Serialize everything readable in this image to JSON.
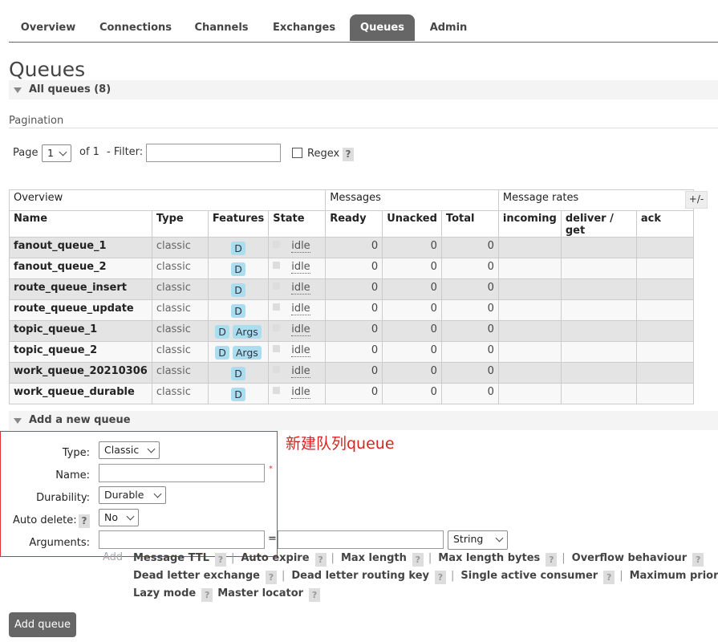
{
  "tabs": [
    "Overview",
    "Connections",
    "Channels",
    "Exchanges",
    "Queues",
    "Admin"
  ],
  "page_title": "Queues",
  "all_queues_label": "All queues (8)",
  "pagination": {
    "label": "Pagination",
    "page_label": "Page",
    "page_value": "1",
    "of_label": "of 1",
    "filter_label": "- Filter:",
    "filter_value": "",
    "regex_label": "Regex",
    "help": "?"
  },
  "table": {
    "group_headers": [
      "Overview",
      "Messages",
      "Message rates"
    ],
    "plus_minus": "+/-",
    "columns": [
      "Name",
      "Type",
      "Features",
      "State",
      "Ready",
      "Unacked",
      "Total",
      "incoming",
      "deliver / get",
      "ack"
    ],
    "rows": [
      {
        "name": "fanout_queue_1",
        "type": "classic",
        "features": [
          "D"
        ],
        "state": "idle",
        "ready": "0",
        "unacked": "0",
        "total": "0"
      },
      {
        "name": "fanout_queue_2",
        "type": "classic",
        "features": [
          "D"
        ],
        "state": "idle",
        "ready": "0",
        "unacked": "0",
        "total": "0"
      },
      {
        "name": "route_queue_insert",
        "type": "classic",
        "features": [
          "D"
        ],
        "state": "idle",
        "ready": "0",
        "unacked": "0",
        "total": "0"
      },
      {
        "name": "route_queue_update",
        "type": "classic",
        "features": [
          "D"
        ],
        "state": "idle",
        "ready": "0",
        "unacked": "0",
        "total": "0"
      },
      {
        "name": "topic_queue_1",
        "type": "classic",
        "features": [
          "D",
          "Args"
        ],
        "state": "idle",
        "ready": "0",
        "unacked": "0",
        "total": "0"
      },
      {
        "name": "topic_queue_2",
        "type": "classic",
        "features": [
          "D",
          "Args"
        ],
        "state": "idle",
        "ready": "0",
        "unacked": "0",
        "total": "0"
      },
      {
        "name": "work_queue_20210306",
        "type": "classic",
        "features": [
          "D"
        ],
        "state": "idle",
        "ready": "0",
        "unacked": "0",
        "total": "0"
      },
      {
        "name": "work_queue_durable",
        "type": "classic",
        "features": [
          "D"
        ],
        "state": "idle",
        "ready": "0",
        "unacked": "0",
        "total": "0"
      }
    ]
  },
  "add_queue": {
    "section_label": "Add a new queue",
    "annotation": "新建队列queue",
    "type_label": "Type:",
    "type_value": "Classic",
    "name_label": "Name:",
    "name_value": "",
    "required_mark": "*",
    "durability_label": "Durability:",
    "durability_value": "Durable",
    "auto_delete_label": "Auto delete:",
    "auto_delete_value": "No",
    "arguments_label": "Arguments:",
    "equals": "=",
    "arg_type_value": "String",
    "add_label": "Add",
    "arg_links_row1": [
      "Message TTL",
      "Auto expire",
      "Max length",
      "Max length bytes",
      "Overflow behaviour"
    ],
    "arg_links_row2": [
      "Dead letter exchange",
      "Dead letter routing key",
      "Single active consumer",
      "Maximum priority"
    ],
    "arg_links_row3": [
      "Lazy mode",
      "Master locator"
    ],
    "submit_label": "Add queue"
  },
  "colors": {
    "tab_active": "#666666",
    "badge": "#aaddee",
    "annotation": "#e02020"
  },
  "icons": {
    "collapse": "triangle-down-icon",
    "select": "chevron-down-icon"
  }
}
